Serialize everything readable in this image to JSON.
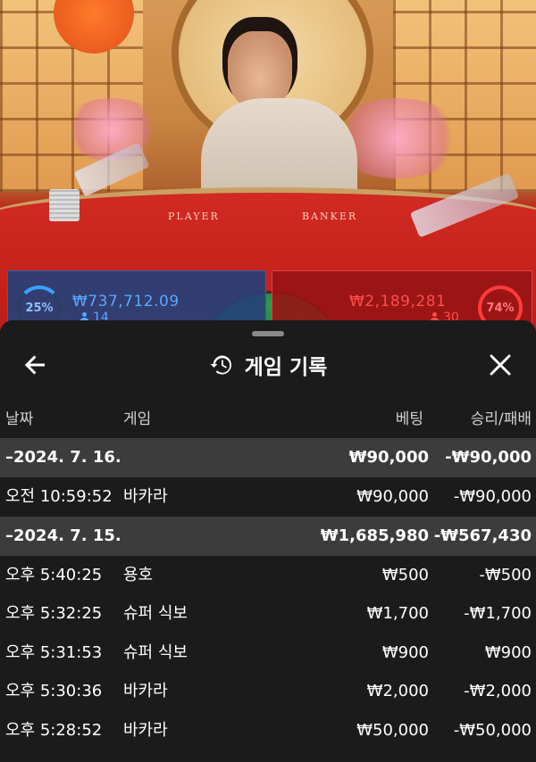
{
  "stream": {
    "felt_player_label": "PLAYER",
    "felt_banker_label": "BANKER",
    "player_bet": {
      "percent": "25%",
      "amount": "₩737,712.09",
      "players": "14"
    },
    "banker_bet": {
      "percent": "74%",
      "amount": "₩2,189,281",
      "players": "30"
    },
    "colors": {
      "player": "#3aa0ff",
      "banker": "#ff3b3b",
      "felt": "#c81f19"
    }
  },
  "sheet": {
    "title": "게임 기록",
    "title_icon": "history-icon",
    "back_icon": "arrow-left-icon",
    "close_icon": "close-icon",
    "headers": {
      "date": "날짜",
      "game": "게임",
      "bet": "베팅",
      "result": "승리/패배"
    },
    "groups": [
      {
        "date": "2024. 7. 16.",
        "bet_total": "₩90,000",
        "result_total": "-₩90,000",
        "items": [
          {
            "time": "오전 10:59:52",
            "game": "바카라",
            "bet": "₩90,000",
            "result": "-₩90,000"
          }
        ]
      },
      {
        "date": "2024. 7. 15.",
        "bet_total": "₩1,685,980",
        "result_total": "-₩567,430",
        "items": [
          {
            "time": "오후 5:40:25",
            "game": "용호",
            "bet": "₩500",
            "result": "-₩500"
          },
          {
            "time": "오후 5:32:25",
            "game": "슈퍼 식보",
            "bet": "₩1,700",
            "result": "-₩1,700"
          },
          {
            "time": "오후 5:31:53",
            "game": "슈퍼 식보",
            "bet": "₩900",
            "result": "₩900"
          },
          {
            "time": "오후 5:30:36",
            "game": "바카라",
            "bet": "₩2,000",
            "result": "-₩2,000"
          },
          {
            "time": "오후 5:28:52",
            "game": "바카라",
            "bet": "₩50,000",
            "result": "-₩50,000"
          }
        ]
      }
    ]
  }
}
